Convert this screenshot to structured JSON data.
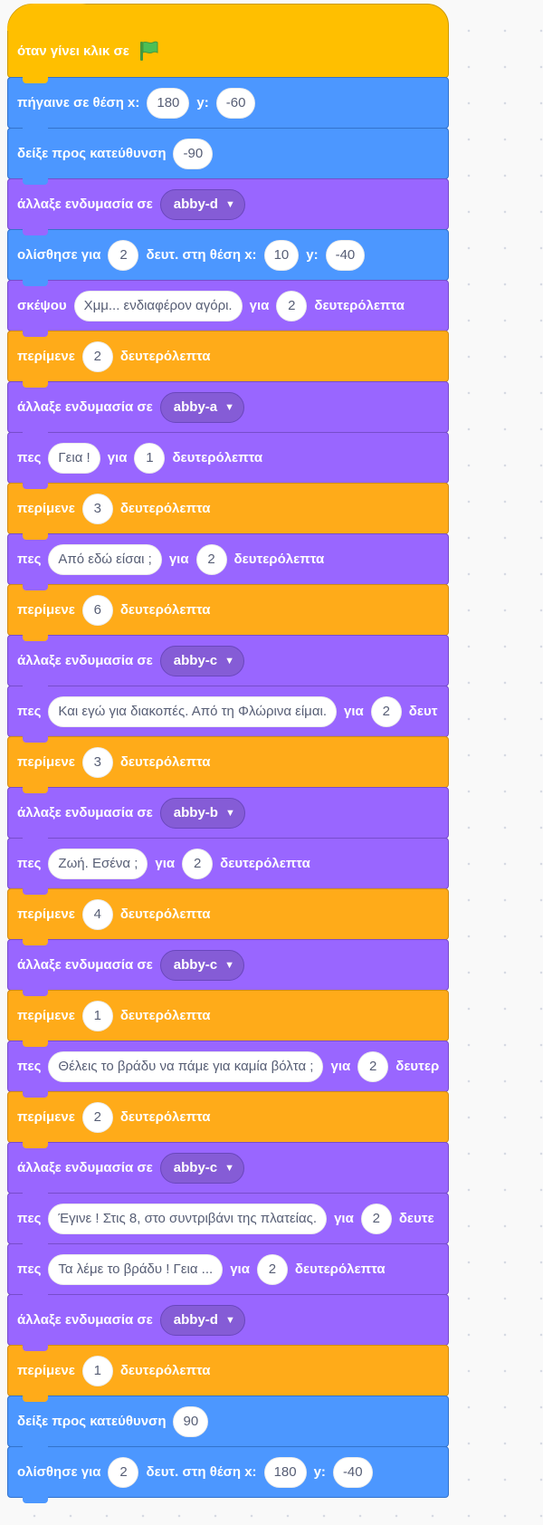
{
  "workspace": {
    "script": {
      "hat": {
        "label": "όταν γίνει κλικ σε",
        "icon": "green-flag-icon"
      },
      "blocks": [
        {
          "category": "motion",
          "parts": [
            {
              "type": "text",
              "v": "πήγαινε σε θέση x:"
            },
            {
              "type": "input",
              "v": "180"
            },
            {
              "type": "text",
              "v": "y:"
            },
            {
              "type": "input",
              "v": "-60"
            }
          ]
        },
        {
          "category": "motion",
          "parts": [
            {
              "type": "text",
              "v": "δείξε προς κατεύθυνση"
            },
            {
              "type": "input",
              "v": "-90"
            }
          ]
        },
        {
          "category": "looks",
          "parts": [
            {
              "type": "text",
              "v": "άλλαξε ενδυμασία σε"
            },
            {
              "type": "menu",
              "v": "abby-d"
            }
          ]
        },
        {
          "category": "motion",
          "parts": [
            {
              "type": "text",
              "v": "ολίσθησε για"
            },
            {
              "type": "input",
              "v": "2"
            },
            {
              "type": "text",
              "v": "δευτ. στη θέση x:"
            },
            {
              "type": "input",
              "v": "10"
            },
            {
              "type": "text",
              "v": "y:"
            },
            {
              "type": "input",
              "v": "-40"
            }
          ]
        },
        {
          "category": "looks",
          "parts": [
            {
              "type": "text",
              "v": "σκέψου"
            },
            {
              "type": "input",
              "v": "Χμμ... ενδιαφέρον αγόρι."
            },
            {
              "type": "text",
              "v": "για"
            },
            {
              "type": "input",
              "v": "2"
            },
            {
              "type": "text",
              "v": "δευτερόλεπτα"
            }
          ]
        },
        {
          "category": "control",
          "parts": [
            {
              "type": "text",
              "v": "περίμενε"
            },
            {
              "type": "input",
              "v": "2"
            },
            {
              "type": "text",
              "v": "δευτερόλεπτα"
            }
          ]
        },
        {
          "category": "looks",
          "parts": [
            {
              "type": "text",
              "v": "άλλαξε ενδυμασία σε"
            },
            {
              "type": "menu",
              "v": "abby-a"
            }
          ]
        },
        {
          "category": "looks",
          "parts": [
            {
              "type": "text",
              "v": "πες"
            },
            {
              "type": "input",
              "v": "Γεια !"
            },
            {
              "type": "text",
              "v": "για"
            },
            {
              "type": "input",
              "v": "1"
            },
            {
              "type": "text",
              "v": "δευτερόλεπτα"
            }
          ]
        },
        {
          "category": "control",
          "parts": [
            {
              "type": "text",
              "v": "περίμενε"
            },
            {
              "type": "input",
              "v": "3"
            },
            {
              "type": "text",
              "v": "δευτερόλεπτα"
            }
          ]
        },
        {
          "category": "looks",
          "parts": [
            {
              "type": "text",
              "v": "πες"
            },
            {
              "type": "input",
              "v": "Από εδώ είσαι ;"
            },
            {
              "type": "text",
              "v": "για"
            },
            {
              "type": "input",
              "v": "2"
            },
            {
              "type": "text",
              "v": "δευτερόλεπτα"
            }
          ]
        },
        {
          "category": "control",
          "parts": [
            {
              "type": "text",
              "v": "περίμενε"
            },
            {
              "type": "input",
              "v": "6"
            },
            {
              "type": "text",
              "v": "δευτερόλεπτα"
            }
          ]
        },
        {
          "category": "looks",
          "parts": [
            {
              "type": "text",
              "v": "άλλαξε ενδυμασία σε"
            },
            {
              "type": "menu",
              "v": "abby-c"
            }
          ]
        },
        {
          "category": "looks",
          "parts": [
            {
              "type": "text",
              "v": "πες"
            },
            {
              "type": "input",
              "v": "Και εγώ για διακοπές. Από τη Φλώρινα είμαι."
            },
            {
              "type": "text",
              "v": "για"
            },
            {
              "type": "input",
              "v": "2"
            },
            {
              "type": "text",
              "v": "δευτ"
            }
          ]
        },
        {
          "category": "control",
          "parts": [
            {
              "type": "text",
              "v": "περίμενε"
            },
            {
              "type": "input",
              "v": "3"
            },
            {
              "type": "text",
              "v": "δευτερόλεπτα"
            }
          ]
        },
        {
          "category": "looks",
          "parts": [
            {
              "type": "text",
              "v": "άλλαξε ενδυμασία σε"
            },
            {
              "type": "menu",
              "v": "abby-b"
            }
          ]
        },
        {
          "category": "looks",
          "parts": [
            {
              "type": "text",
              "v": "πες"
            },
            {
              "type": "input",
              "v": "Ζωή. Εσένα ;"
            },
            {
              "type": "text",
              "v": "για"
            },
            {
              "type": "input",
              "v": "2"
            },
            {
              "type": "text",
              "v": "δευτερόλεπτα"
            }
          ]
        },
        {
          "category": "control",
          "parts": [
            {
              "type": "text",
              "v": "περίμενε"
            },
            {
              "type": "input",
              "v": "4"
            },
            {
              "type": "text",
              "v": "δευτερόλεπτα"
            }
          ]
        },
        {
          "category": "looks",
          "parts": [
            {
              "type": "text",
              "v": "άλλαξε ενδυμασία σε"
            },
            {
              "type": "menu",
              "v": "abby-c"
            }
          ]
        },
        {
          "category": "control",
          "parts": [
            {
              "type": "text",
              "v": "περίμενε"
            },
            {
              "type": "input",
              "v": "1"
            },
            {
              "type": "text",
              "v": "δευτερόλεπτα"
            }
          ]
        },
        {
          "category": "looks",
          "parts": [
            {
              "type": "text",
              "v": "πες"
            },
            {
              "type": "input",
              "v": "Θέλεις το βράδυ να πάμε για καμία βόλτα ;"
            },
            {
              "type": "text",
              "v": "για"
            },
            {
              "type": "input",
              "v": "2"
            },
            {
              "type": "text",
              "v": "δευτερ"
            }
          ]
        },
        {
          "category": "control",
          "parts": [
            {
              "type": "text",
              "v": "περίμενε"
            },
            {
              "type": "input",
              "v": "2"
            },
            {
              "type": "text",
              "v": "δευτερόλεπτα"
            }
          ]
        },
        {
          "category": "looks",
          "parts": [
            {
              "type": "text",
              "v": "άλλαξε ενδυμασία σε"
            },
            {
              "type": "menu",
              "v": "abby-c"
            }
          ]
        },
        {
          "category": "looks",
          "parts": [
            {
              "type": "text",
              "v": "πες"
            },
            {
              "type": "input",
              "v": "Έγινε ! Στις 8, στο συντριβάνι της πλατείας."
            },
            {
              "type": "text",
              "v": "για"
            },
            {
              "type": "input",
              "v": "2"
            },
            {
              "type": "text",
              "v": "δευτε"
            }
          ]
        },
        {
          "category": "looks",
          "parts": [
            {
              "type": "text",
              "v": "πες"
            },
            {
              "type": "input",
              "v": "Τα λέμε το βράδυ ! Γεια ..."
            },
            {
              "type": "text",
              "v": "για"
            },
            {
              "type": "input",
              "v": "2"
            },
            {
              "type": "text",
              "v": "δευτερόλεπτα"
            }
          ]
        },
        {
          "category": "looks",
          "parts": [
            {
              "type": "text",
              "v": "άλλαξε ενδυμασία σε"
            },
            {
              "type": "menu",
              "v": "abby-d"
            }
          ]
        },
        {
          "category": "control",
          "parts": [
            {
              "type": "text",
              "v": "περίμενε"
            },
            {
              "type": "input",
              "v": "1"
            },
            {
              "type": "text",
              "v": "δευτερόλεπτα"
            }
          ]
        },
        {
          "category": "motion",
          "parts": [
            {
              "type": "text",
              "v": "δείξε προς κατεύθυνση"
            },
            {
              "type": "input",
              "v": "90"
            }
          ]
        },
        {
          "category": "motion",
          "parts": [
            {
              "type": "text",
              "v": "ολίσθησε για"
            },
            {
              "type": "input",
              "v": "2"
            },
            {
              "type": "text",
              "v": "δευτ. στη θέση x:"
            },
            {
              "type": "input",
              "v": "180"
            },
            {
              "type": "text",
              "v": "y:"
            },
            {
              "type": "input",
              "v": "-40"
            }
          ]
        }
      ]
    }
  },
  "colors": {
    "motion": "#4c97ff",
    "looks": "#9966ff",
    "control": "#ffab19",
    "events": "#ffbf00",
    "flag": "#4cbf56"
  }
}
